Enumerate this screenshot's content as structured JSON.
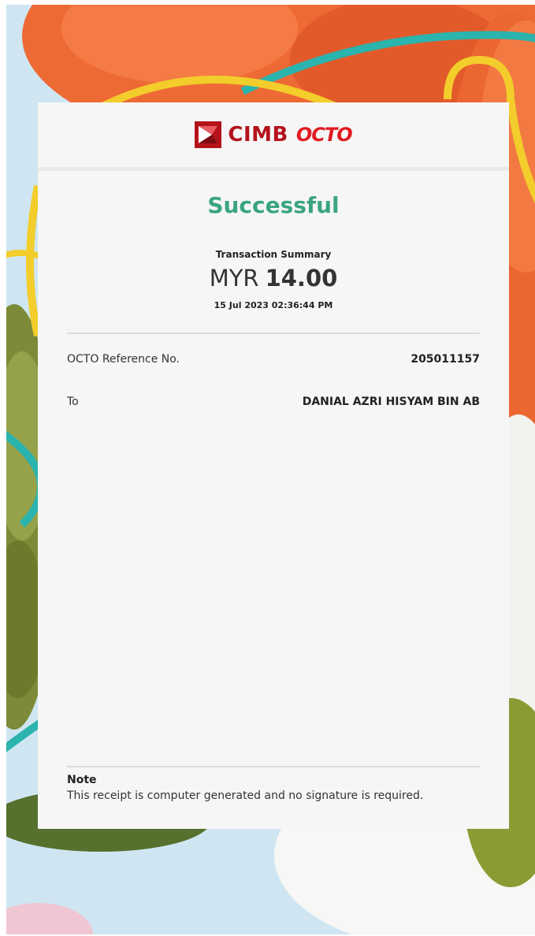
{
  "brand": {
    "name": "CIMB",
    "product": "OCTO",
    "primary_color": "#b5121b",
    "octo_color": "#e11b22"
  },
  "receipt": {
    "status": "Successful",
    "status_color": "#3aa57e",
    "summary_label": "Transaction Summary",
    "currency": "MYR",
    "amount": "14.00",
    "datetime": "15 Jul 2023 02:36:44 PM",
    "details": [
      {
        "label": "OCTO Reference No.",
        "value": "205011157"
      },
      {
        "label": "To",
        "value": "DANIAL AZRI HISYAM BIN AB"
      }
    ],
    "note": {
      "title": "Note",
      "text": "This receipt is computer generated and no signature is required."
    }
  },
  "icons": {
    "logo_mark": "cimb-logo-icon"
  }
}
